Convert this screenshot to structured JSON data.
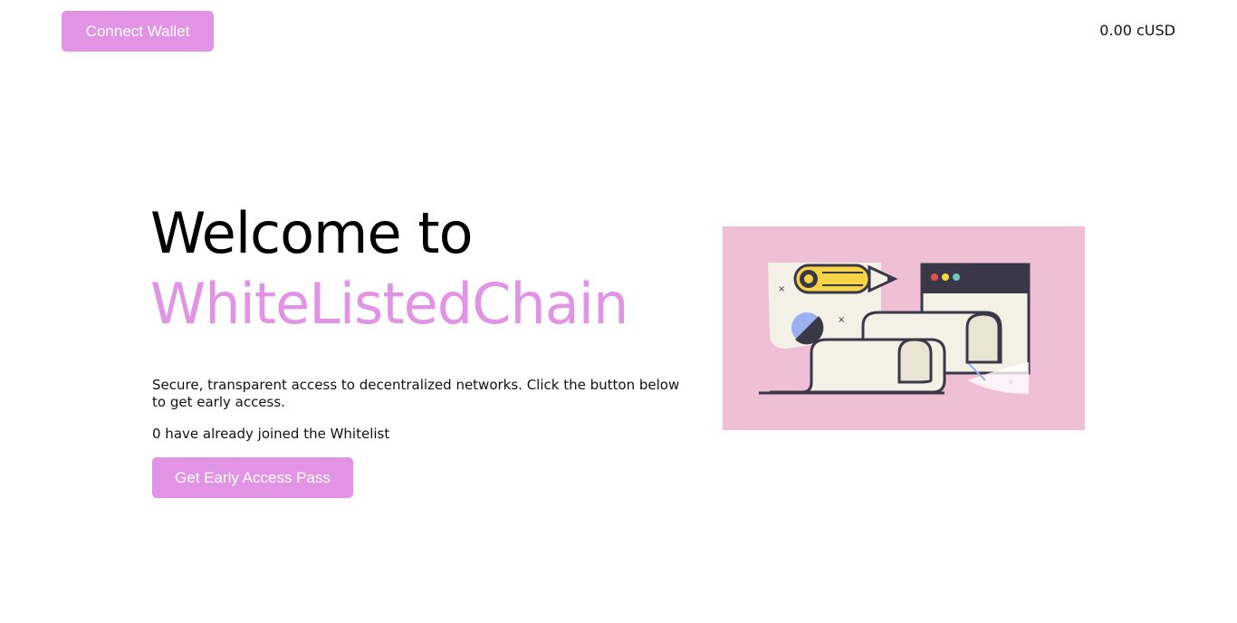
{
  "header": {
    "connect_label": "Connect Wallet",
    "balance": "0.00 cUSD"
  },
  "hero": {
    "title_line1": "Welcome to",
    "title_line2": "WhiteListedChain",
    "description": "Secure, transparent access to decentralized networks. Click the button below to get early access.",
    "joined_text": "0 have already joined the Whitelist",
    "cta_label": "Get Early Access Pass"
  },
  "illustration": {
    "icon": "pencil-and-scroll-illustration",
    "background_color": "#efbfd6"
  },
  "colors": {
    "accent": "#e194e4",
    "text": "#000000"
  }
}
